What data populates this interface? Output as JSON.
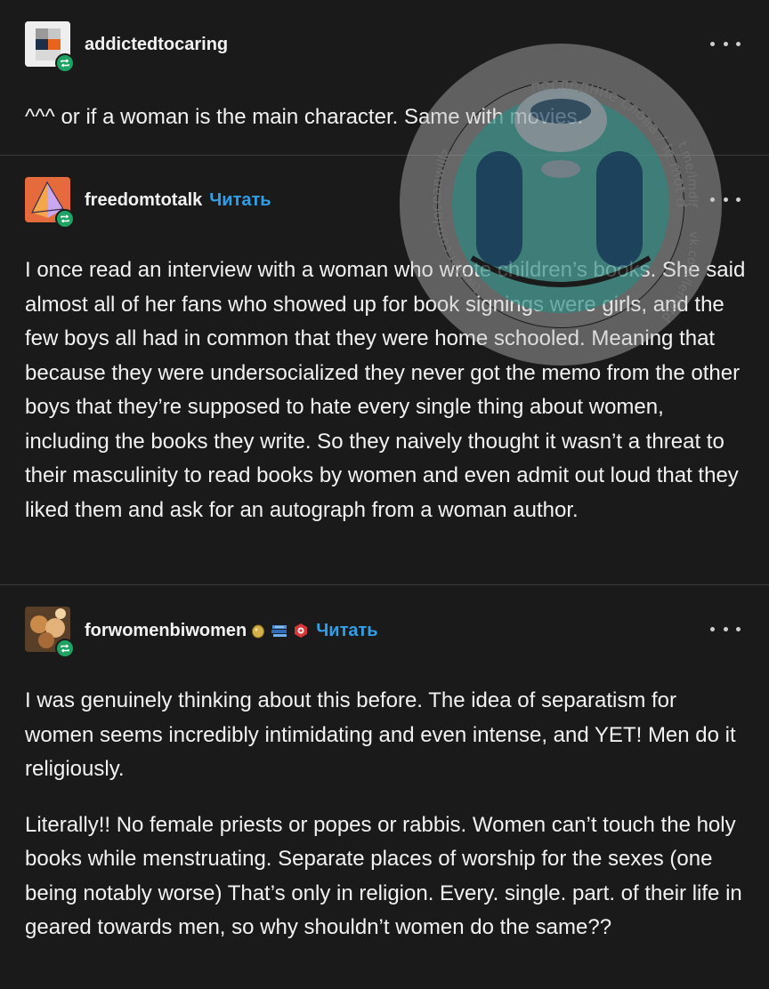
{
  "posts": [
    {
      "username": "addictedtocaring",
      "follow_label": "",
      "paragraphs": [
        "^^^ or if a woman is the main character. Same with movies."
      ]
    },
    {
      "username": "freedomtotalk",
      "follow_label": "Читать",
      "paragraphs": [
        "I once read an interview with a woman who wrote children’s books. She said almost all of her fans who showed up for book signings were girls, and the few boys all had in common that they were home schooled. Meaning that because they were undersocialized they never got the memo from the other boys that they’re supposed to hate every single thing about women, including the books they write. So they naively thought it wasn’t a threat to their masculinity to read books by women and even admit out loud that they liked them and ask for an autograph from a woman author."
      ]
    },
    {
      "username": "forwomenbiwomen",
      "follow_label": "Читать",
      "paragraphs": [
        "I was genuinely thinking about this before. The idea of separatism for women seems incredibly intimidating and even intense, and YET! Men do it religiously.",
        "Literally!! No female priests or popes or rabbis. Women can’t touch the holy books while menstruating. Separate places of worship for the sexes (one being notably worse) That’s only in religion. Every. single. part. of their life in geared towards men, so why shouldn’t women do the same??"
      ]
    }
  ],
  "watermark": {
    "ring_text": "последние слова / le mot de la fin",
    "left_text": "twitter.com/oceanwillz",
    "right_text_1": "t.me/lmdlf",
    "right_text_2": "vk.com/lemotdelafin"
  },
  "colors": {
    "background": "#1a1a1a",
    "text": "#f2f2f2",
    "follow_link": "#2e9fe8",
    "reblog_badge": "#1fa364"
  },
  "icons": [
    "reblog-icon",
    "more-options-icon"
  ]
}
